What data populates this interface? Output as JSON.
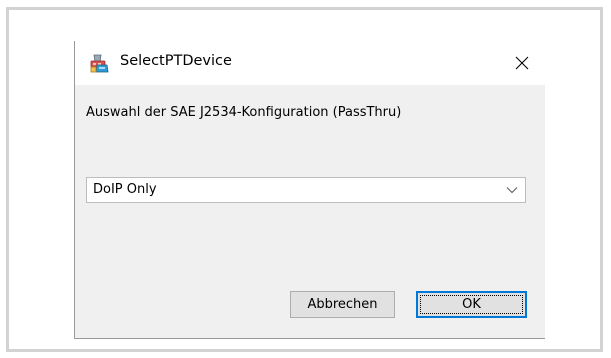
{
  "window": {
    "title": "SelectPTDevice",
    "close_icon": "close-icon",
    "app_icon": "app-icon"
  },
  "content": {
    "prompt": "Auswahl der SAE J2534-Konfiguration (PassThru)",
    "select": {
      "value": "DoIP Only",
      "icon": "chevron-down-icon"
    }
  },
  "buttons": {
    "cancel_label": "Abbrechen",
    "ok_label": "OK"
  },
  "colors": {
    "dialog_background": "#f0f0f0",
    "title_bar_background": "#ffffff",
    "focus_accent": "#0078d7",
    "frame_border": "#d3d3d3"
  }
}
